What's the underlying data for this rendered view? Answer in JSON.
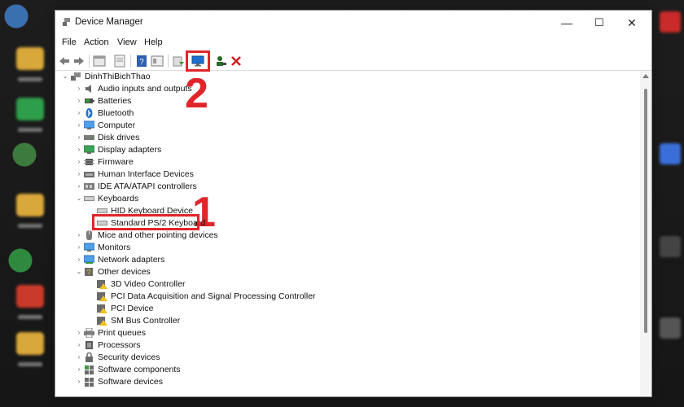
{
  "window": {
    "title": "Device Manager",
    "minimize": "—",
    "maximize": "☐",
    "close": "✕"
  },
  "menu": [
    "File",
    "Action",
    "View",
    "Help"
  ],
  "callouts": {
    "one": "1",
    "two": "2"
  },
  "tree": {
    "root": "DinhThiBichThao",
    "items": [
      {
        "label": "Audio inputs and outputs",
        "icon": "speaker-icon",
        "expanded": false
      },
      {
        "label": "Batteries",
        "icon": "battery-icon",
        "expanded": false
      },
      {
        "label": "Bluetooth",
        "icon": "bluetooth-icon",
        "expanded": false
      },
      {
        "label": "Computer",
        "icon": "monitor-icon",
        "expanded": false
      },
      {
        "label": "Disk drives",
        "icon": "disk-icon",
        "expanded": false
      },
      {
        "label": "Display adapters",
        "icon": "display-adapter-icon",
        "expanded": false
      },
      {
        "label": "Firmware",
        "icon": "chip-icon",
        "expanded": false
      },
      {
        "label": "Human Interface Devices",
        "icon": "hid-icon",
        "expanded": false
      },
      {
        "label": "IDE ATA/ATAPI controllers",
        "icon": "controller-icon",
        "expanded": false
      },
      {
        "label": "Keyboards",
        "icon": "keyboard-icon",
        "expanded": true,
        "children": [
          "HID Keyboard Device",
          "Standard PS/2 Keyboard"
        ]
      },
      {
        "label": "Mice and other pointing devices",
        "icon": "mouse-icon",
        "expanded": false
      },
      {
        "label": "Monitors",
        "icon": "monitor-icon",
        "expanded": false
      },
      {
        "label": "Network adapters",
        "icon": "network-icon",
        "expanded": false
      },
      {
        "label": "Other devices",
        "icon": "unknown-device-icon",
        "expanded": true,
        "children": [
          "3D Video Controller",
          "PCI Data Acquisition and Signal Processing Controller",
          "PCI Device",
          "SM Bus Controller"
        ]
      },
      {
        "label": "Print queues",
        "icon": "printer-icon",
        "expanded": false
      },
      {
        "label": "Processors",
        "icon": "processor-icon",
        "expanded": false
      },
      {
        "label": "Security devices",
        "icon": "security-icon",
        "expanded": false
      },
      {
        "label": "Software components",
        "icon": "component-icon",
        "expanded": false
      },
      {
        "label": "Software devices",
        "icon": "component-icon",
        "expanded": false
      }
    ]
  },
  "colors": {
    "highlight": "#e0262b",
    "accent": "#1f6fd1"
  }
}
